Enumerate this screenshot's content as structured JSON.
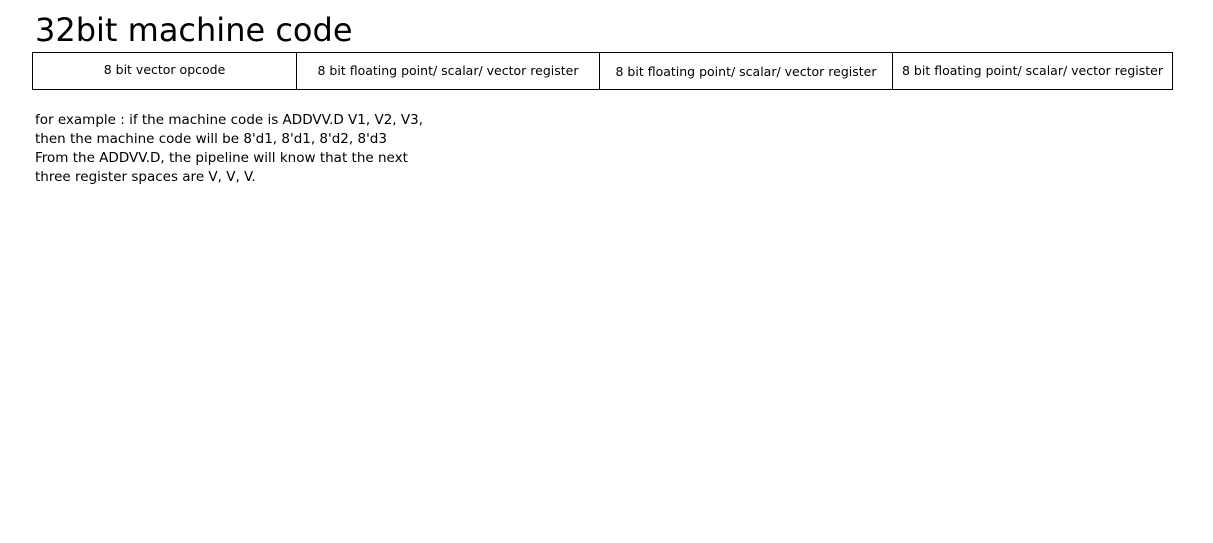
{
  "title": "32bit machine code",
  "fields": [
    "8 bit vector opcode",
    "8 bit floating point/ scalar/ vector register",
    "8 bit floating point/ scalar/ vector register",
    "8 bit floating point/ scalar/ vector register"
  ],
  "notes": [
    "for example : if the machine code is ADDVV.D V1, V2, V3,",
    "then the machine code will be 8'd1, 8'd1, 8'd2, 8'd3",
    "From the ADDVV.D, the pipeline will know that the next",
    "three register spaces are V, V, V."
  ]
}
